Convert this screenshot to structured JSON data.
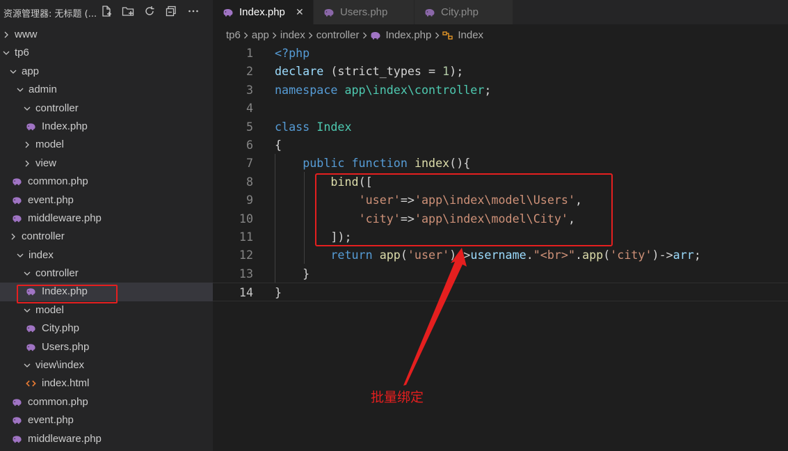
{
  "explorer": {
    "title": "资源管理器: 无标题 (...",
    "header_icons": [
      "new-file-icon",
      "new-folder-icon",
      "refresh-icon",
      "collapse-all-icon",
      "more-icon"
    ],
    "items": [
      {
        "label": "www",
        "type": "folder",
        "expanded": false
      },
      {
        "label": "tp6",
        "type": "folder",
        "expanded": true
      },
      {
        "label": "app",
        "type": "folder",
        "expanded": true
      },
      {
        "label": "admin",
        "type": "folder",
        "expanded": true
      },
      {
        "label": "controller",
        "type": "folder",
        "expanded": true
      },
      {
        "label": "Index.php",
        "type": "php"
      },
      {
        "label": "model",
        "type": "folder",
        "expanded": false
      },
      {
        "label": "view",
        "type": "folder",
        "expanded": false
      },
      {
        "label": "common.php",
        "type": "php"
      },
      {
        "label": "event.php",
        "type": "php"
      },
      {
        "label": "middleware.php",
        "type": "php"
      },
      {
        "label": "controller",
        "type": "folder",
        "expanded": false
      },
      {
        "label": "index",
        "type": "folder",
        "expanded": true
      },
      {
        "label": "controller",
        "type": "folder",
        "expanded": true
      },
      {
        "label": "Index.php",
        "type": "php",
        "selected": true
      },
      {
        "label": "model",
        "type": "folder",
        "expanded": true
      },
      {
        "label": "City.php",
        "type": "php"
      },
      {
        "label": "Users.php",
        "type": "php"
      },
      {
        "label": "view\\index",
        "type": "folder",
        "expanded": true
      },
      {
        "label": "index.html",
        "type": "html"
      },
      {
        "label": "common.php",
        "type": "php"
      },
      {
        "label": "event.php",
        "type": "php"
      },
      {
        "label": "middleware.php",
        "type": "php"
      }
    ]
  },
  "tabs": [
    {
      "label": "Index.php",
      "active": true,
      "close": "✕"
    },
    {
      "label": "Users.php",
      "active": false
    },
    {
      "label": "City.php",
      "active": false
    }
  ],
  "breadcrumb": [
    "tp6",
    "app",
    "index",
    "controller",
    "Index.php",
    "Index"
  ],
  "editor": {
    "current_line": 14,
    "lines": [
      {
        "n": "1",
        "tokens": [
          [
            "kw",
            "<?php"
          ]
        ]
      },
      {
        "n": "2",
        "tokens": [
          [
            "prop",
            "declare"
          ],
          [
            "pun",
            " (strict_types = "
          ],
          [
            "num",
            "1"
          ],
          [
            "pun",
            ");"
          ]
        ]
      },
      {
        "n": "3",
        "tokens": [
          [
            "kw",
            "namespace"
          ],
          [
            "pun",
            " "
          ],
          [
            "cls",
            "app\\index\\controller"
          ],
          [
            "pun",
            ";"
          ]
        ]
      },
      {
        "n": "4",
        "tokens": []
      },
      {
        "n": "5",
        "tokens": [
          [
            "kw",
            "class"
          ],
          [
            "pun",
            " "
          ],
          [
            "cls",
            "Index"
          ]
        ]
      },
      {
        "n": "6",
        "tokens": [
          [
            "pun",
            "{"
          ]
        ]
      },
      {
        "n": "7",
        "tokens": [
          [
            "pun",
            "    "
          ],
          [
            "kw",
            "public"
          ],
          [
            "pun",
            " "
          ],
          [
            "kw",
            "function"
          ],
          [
            "pun",
            " "
          ],
          [
            "fn",
            "index"
          ],
          [
            "pun",
            "(){"
          ]
        ]
      },
      {
        "n": "8",
        "tokens": [
          [
            "pun",
            "        "
          ],
          [
            "fn",
            "bind"
          ],
          [
            "pun",
            "(["
          ]
        ]
      },
      {
        "n": "9",
        "tokens": [
          [
            "pun",
            "            "
          ],
          [
            "str",
            "'user'"
          ],
          [
            "pun",
            "=>"
          ],
          [
            "str",
            "'app\\index\\model\\Users'"
          ],
          [
            "pun",
            ","
          ]
        ]
      },
      {
        "n": "10",
        "tokens": [
          [
            "pun",
            "            "
          ],
          [
            "str",
            "'city'"
          ],
          [
            "pun",
            "=>"
          ],
          [
            "str",
            "'app\\index\\model\\City'"
          ],
          [
            "pun",
            ","
          ]
        ]
      },
      {
        "n": "11",
        "tokens": [
          [
            "pun",
            "        "
          ],
          [
            "pun",
            "]);"
          ]
        ]
      },
      {
        "n": "12",
        "tokens": [
          [
            "pun",
            "        "
          ],
          [
            "kw",
            "return"
          ],
          [
            "pun",
            " "
          ],
          [
            "fn",
            "app"
          ],
          [
            "pun",
            "("
          ],
          [
            "str",
            "'user'"
          ],
          [
            "pun",
            ")->"
          ],
          [
            "prop",
            "username"
          ],
          [
            "pun",
            "."
          ],
          [
            "str",
            "\"<br>\""
          ],
          [
            "pun",
            "."
          ],
          [
            "fn",
            "app"
          ],
          [
            "pun",
            "("
          ],
          [
            "str",
            "'city'"
          ],
          [
            "pun",
            ")->"
          ],
          [
            "prop",
            "arr"
          ],
          [
            "pun",
            ";"
          ]
        ]
      },
      {
        "n": "13",
        "tokens": [
          [
            "pun",
            "    }"
          ]
        ]
      },
      {
        "n": "14",
        "tokens": [
          [
            "pun",
            "}"
          ]
        ]
      }
    ]
  },
  "annotation": {
    "text": "批量绑定",
    "color": "#e51f1f"
  },
  "colors": {
    "php_icon": "#a074c4",
    "html_icon": "#e37933",
    "highlight_box": "#e51f1f",
    "accent": "#007acc"
  }
}
